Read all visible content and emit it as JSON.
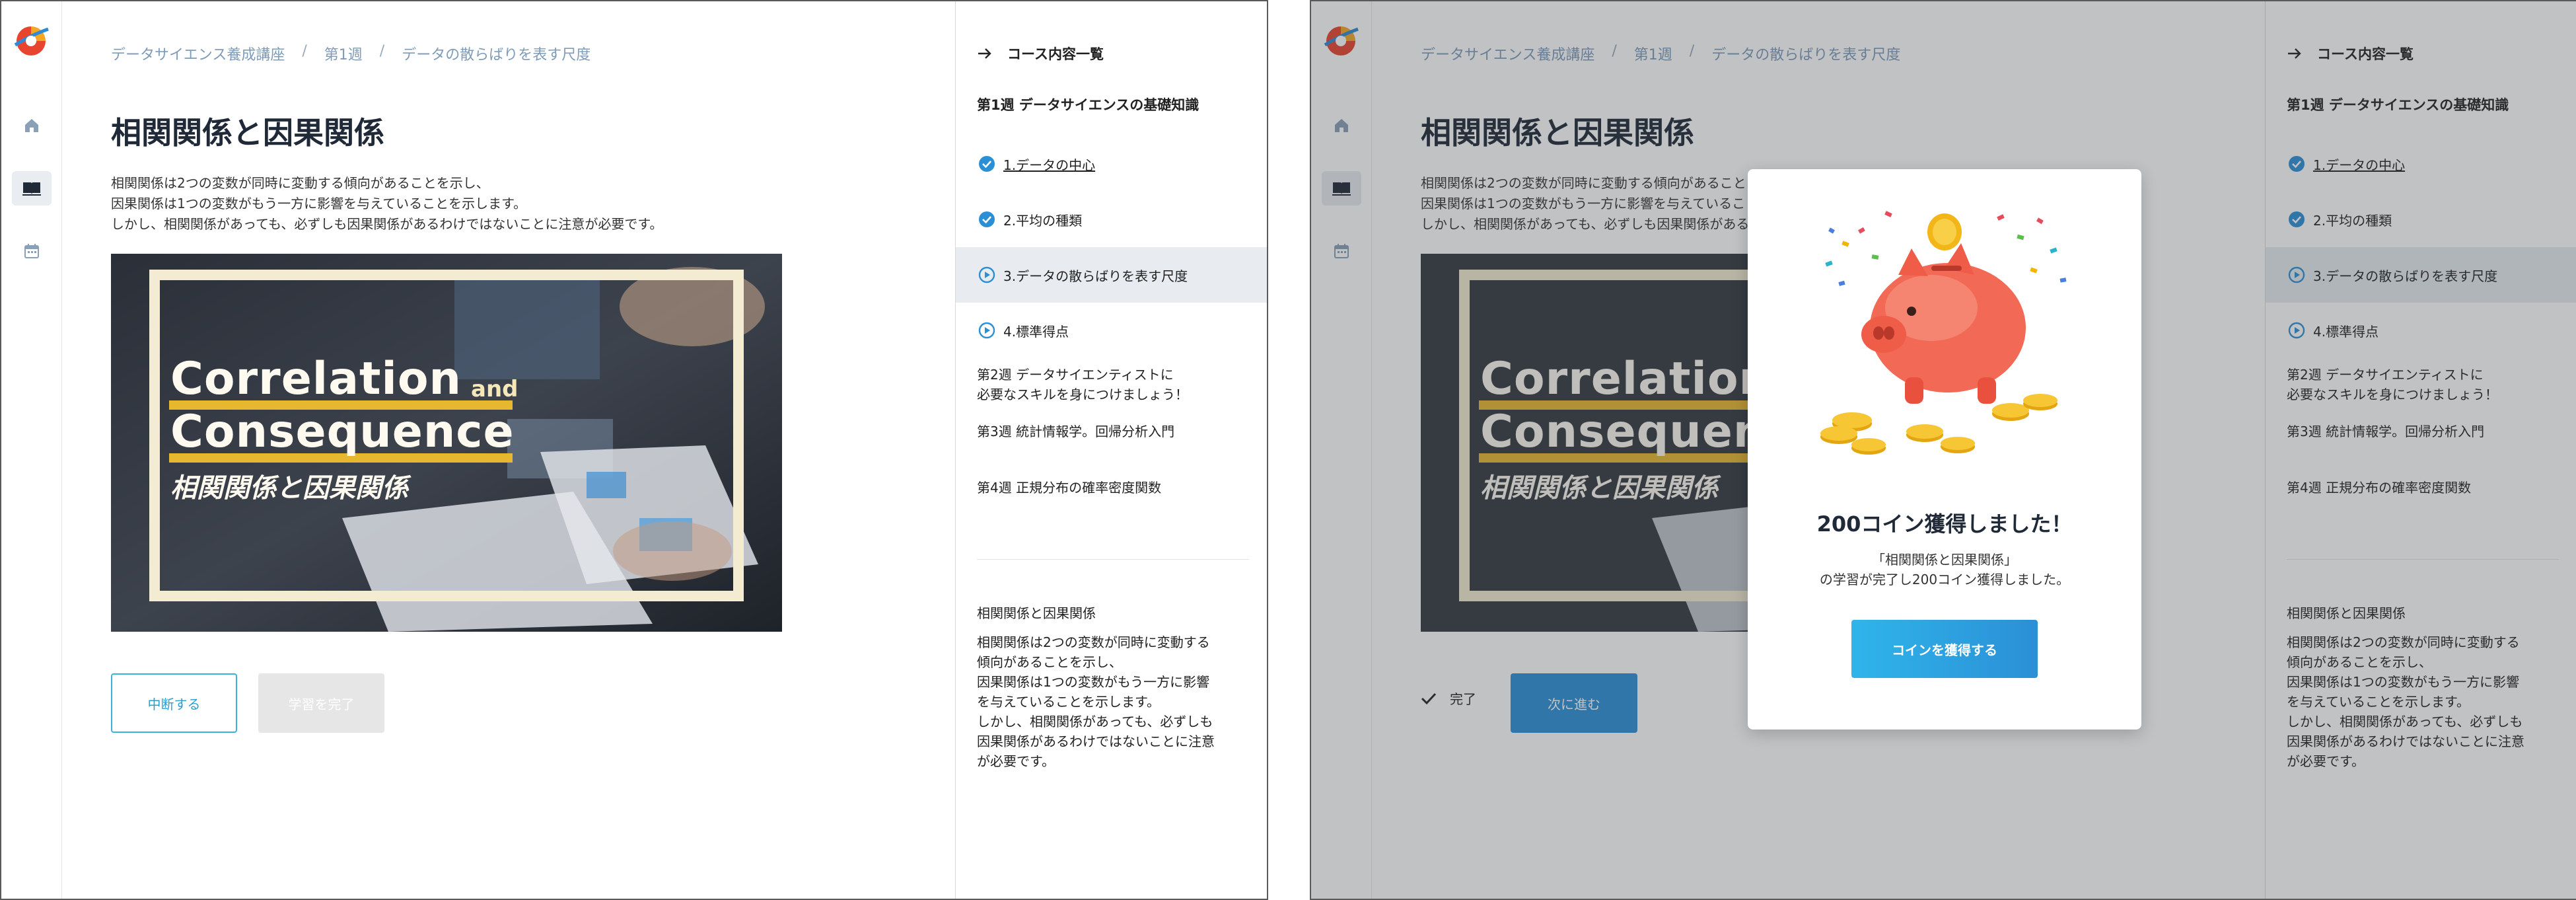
{
  "breadcrumb": [
    "データサイエンス養成講座",
    "第1週",
    "データの散らばりを表す尺度"
  ],
  "breadcrumb_separator": "/",
  "page_title": "相関関係と因果関係",
  "description": [
    "相関関係は2つの変数が同時に変動する傾向があることを示し、",
    "因果関係は1つの変数がもう一方に影響を与えていることを示します。",
    "しかし、相関関係があっても、必ずしも因果関係があるわけではないことに注意が必要です。"
  ],
  "hero": {
    "title_line1": "Correlation",
    "and_text": "and",
    "title_line2": "Consequence",
    "subtitle": "相関関係と因果関係"
  },
  "buttons": {
    "suspend": "中断する",
    "complete": "学習を完了",
    "done_label": "完了",
    "next": "次に進む"
  },
  "sidebar": {
    "header": "コース内容一覧",
    "week1_title": "第1週 データサイエンスの基礎知識",
    "lessons": [
      {
        "label": "1.データの中心",
        "status": "completed",
        "icon": "check-circle-icon"
      },
      {
        "label": "2.平均の種類",
        "status": "completed",
        "icon": "check-circle-icon"
      },
      {
        "label": "3.データの散らばりを表す尺度",
        "status": "current",
        "icon": "play-circle-icon"
      },
      {
        "label": "4.標準得点",
        "status": "not-started",
        "icon": "play-circle-icon"
      }
    ],
    "weeks": [
      {
        "line1": "第2週 データサイエンティストに",
        "line2": "必要なスキルを身につけましょう！"
      },
      {
        "line1": "第3週 統計情報学。回帰分析入門"
      },
      {
        "line1": "第4週 正規分布の確率密度関数"
      }
    ],
    "summary_title": "相関関係と因果関係",
    "summary_lines": [
      "相関関係は2つの変数が同時に変動する",
      "傾向があることを示し、",
      "因果関係は1つの変数がもう一方に影響",
      "を与えていることを示します。",
      "しかし、相関関係があっても、必ずしも",
      "因果関係があるわけではないことに注意",
      "が必要です。"
    ]
  },
  "rail_icons": [
    "home-icon",
    "book-icon",
    "calendar-icon"
  ],
  "modal": {
    "title": "200コイン獲得しました！",
    "line1": "「相関関係と因果関係」",
    "line2": "の学習が完了し200コイン獲得しました。",
    "button": "コインを獲得する"
  },
  "colors": {
    "accent": "#2b8fd6",
    "accent_light": "#3bb1dc",
    "breadcrumb": "#7f9bb8",
    "current_lesson_bg": "#e8ecf0",
    "hero_highlight": "#e7b72e"
  }
}
